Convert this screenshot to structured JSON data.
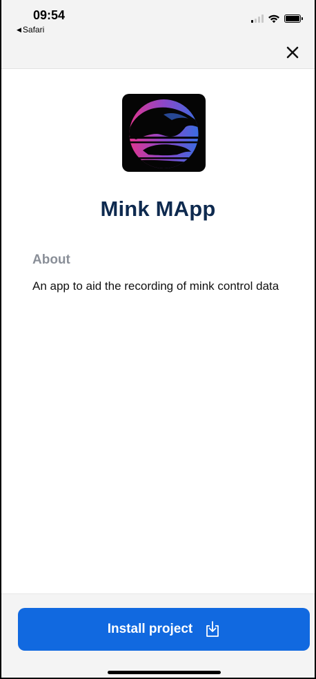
{
  "status_bar": {
    "time": "09:54",
    "back_app": "Safari",
    "back_icon": "back-triangle-icon",
    "signal_icon": "cellular-signal-icon",
    "wifi_icon": "wifi-icon",
    "battery_icon": "battery-icon"
  },
  "header": {
    "close_icon": "close-icon"
  },
  "app": {
    "title": "Mink MApp",
    "logo_icon": "mink-logo-icon"
  },
  "about": {
    "heading": "About",
    "text": "An app to aid the recording of mink control data"
  },
  "footer": {
    "install_label": "Install project",
    "install_icon": "download-icon"
  },
  "colors": {
    "primary": "#1169e0",
    "title": "#0e2a4f",
    "heading_grey": "#8a8f98",
    "logo_gradient_start": "#e0368f",
    "logo_gradient_end": "#3a6ce0"
  }
}
